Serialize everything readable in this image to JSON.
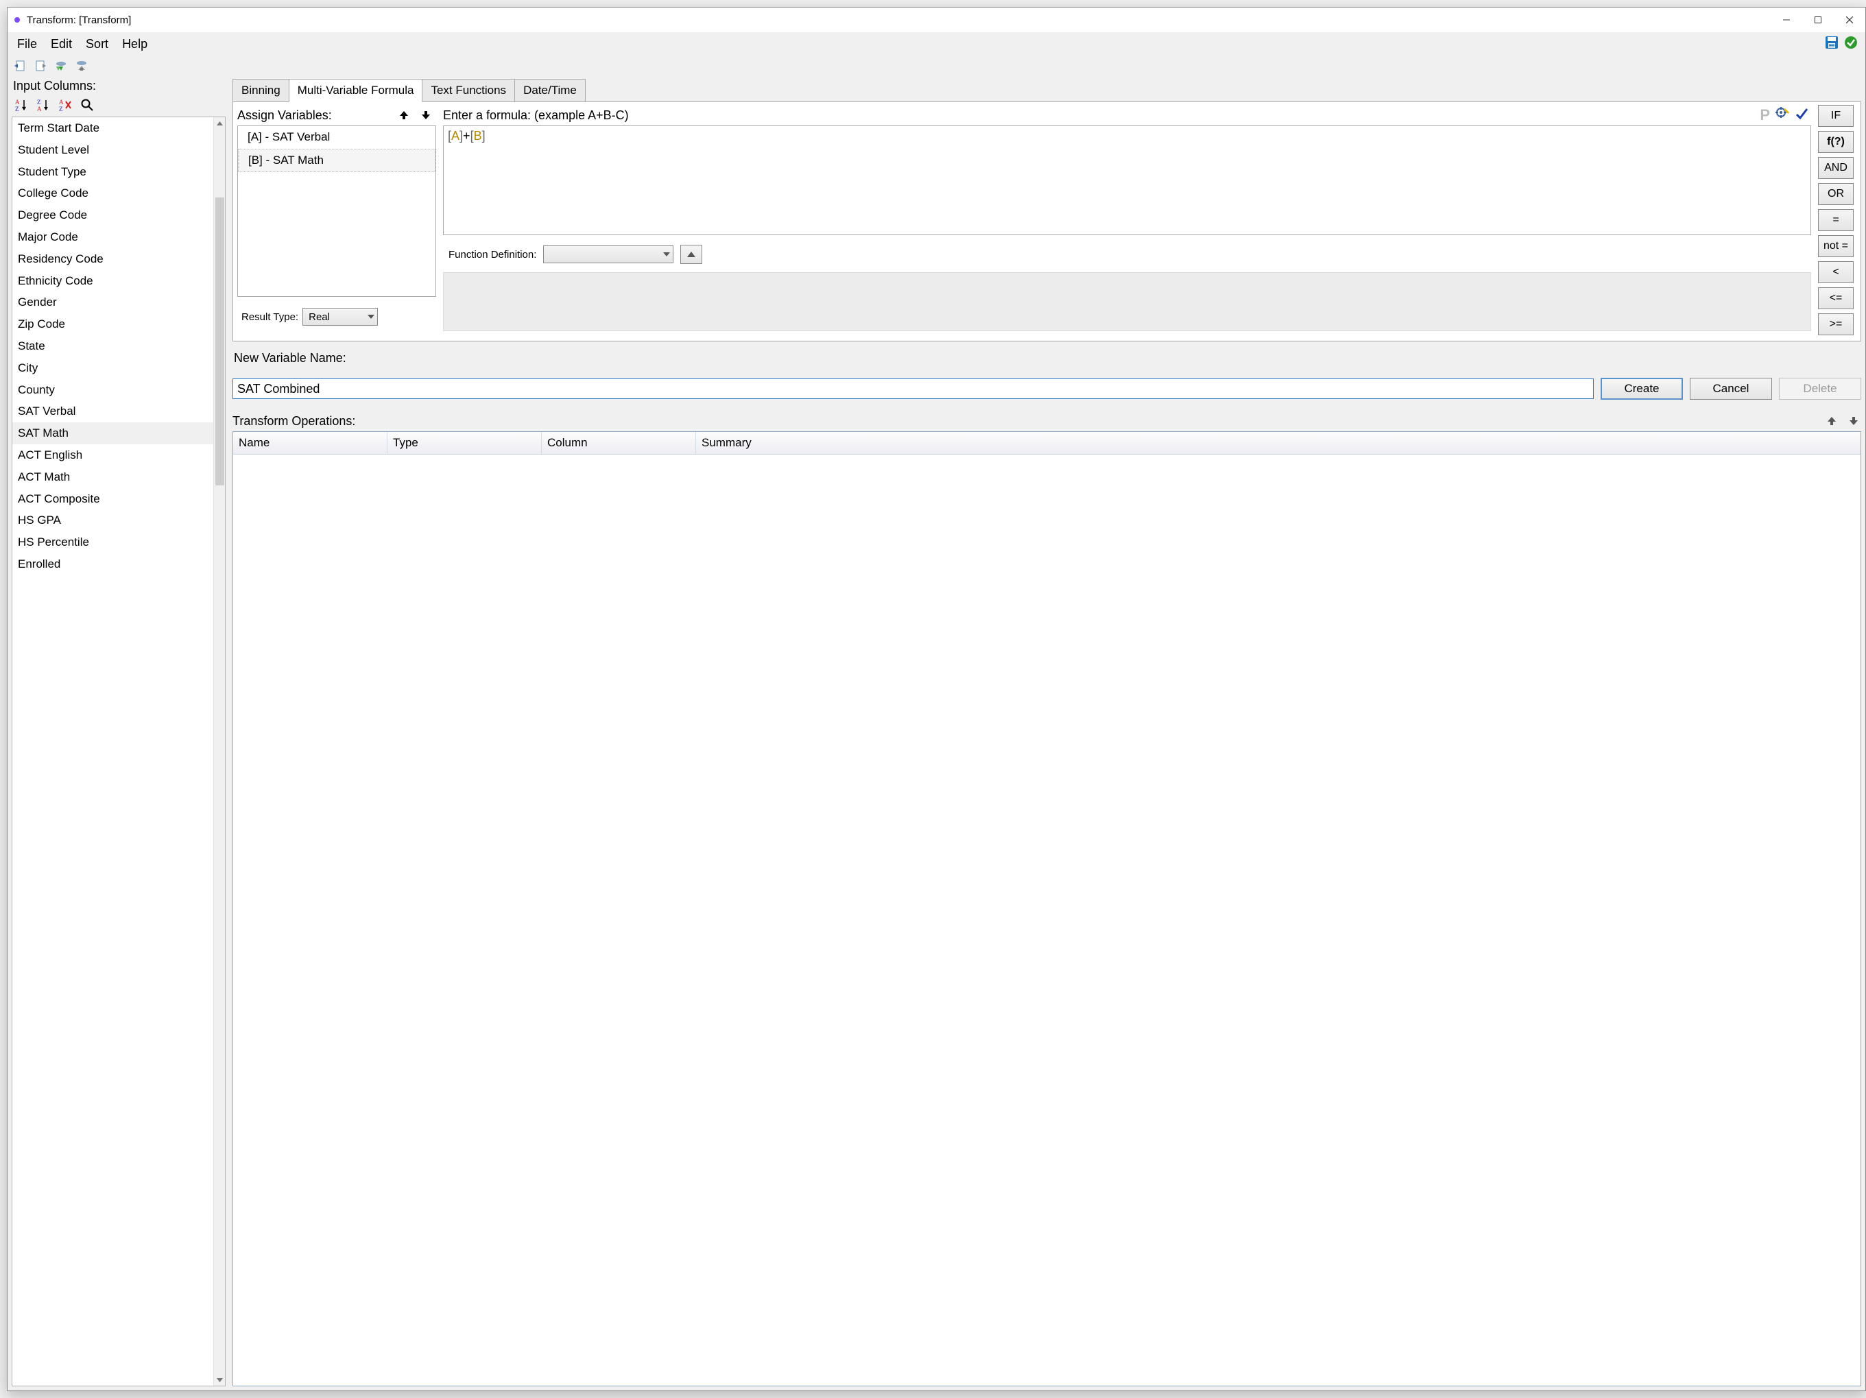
{
  "titlebar": {
    "title": "Transform: [Transform]"
  },
  "menubar": {
    "file": "File",
    "edit": "Edit",
    "sort": "Sort",
    "help": "Help"
  },
  "left": {
    "label": "Input Columns:",
    "sort_asc": "Sort A→Z",
    "sort_desc": "Sort Z→A",
    "sort_clear": "Clear sort",
    "search": "Search",
    "items": [
      "Term Start Date",
      "Student Level",
      "Student Type",
      "College Code",
      "Degree Code",
      "Major Code",
      "Residency Code",
      "Ethnicity Code",
      "Gender",
      "Zip Code",
      "State",
      "City",
      "County",
      "SAT Verbal",
      "SAT Math",
      "ACT English",
      "ACT Math",
      "ACT Composite",
      "HS GPA",
      "HS Percentile",
      "Enrolled"
    ],
    "selectedIndex": 14
  },
  "tabs": {
    "binning": "Binning",
    "multivar": "Multi-Variable Formula",
    "textfn": "Text Functions",
    "datetime": "Date/Time",
    "activeIndex": 1
  },
  "assign": {
    "label": "Assign Variables:",
    "rows": [
      "[A] - SAT Verbal",
      "[B] - SAT Math"
    ],
    "selectedIndex": 1
  },
  "formula": {
    "label": "Enter a formula: (example A+B-C)",
    "varA": "A",
    "varB": "B",
    "funclabel": "Function Definition:",
    "funcvalue": ""
  },
  "resulttype": {
    "label": "Result Type:",
    "value": "Real"
  },
  "ops": {
    "IF": "IF",
    "f": "f(?)",
    "AND": "AND",
    "OR": "OR",
    "EQ": "=",
    "NEQ": "not =",
    "LT": "<",
    "LTE": "<=",
    "GTE": ">="
  },
  "newvar": {
    "label": "New Variable Name:",
    "value": "SAT Combined",
    "create": "Create",
    "cancel": "Cancel",
    "delete": "Delete"
  },
  "trops": {
    "label": "Transform Operations:",
    "cols": {
      "name": "Name",
      "type": "Type",
      "column": "Column",
      "summary": "Summary"
    }
  },
  "icons": {
    "p": "P",
    "save": "save-icon",
    "ok": "checkmark-circle-icon",
    "check": "checkmark-icon",
    "gear": "gear-wand-icon",
    "up": "arrow-up-icon",
    "down": "arrow-down-icon",
    "caret": "chevron-down-icon"
  }
}
